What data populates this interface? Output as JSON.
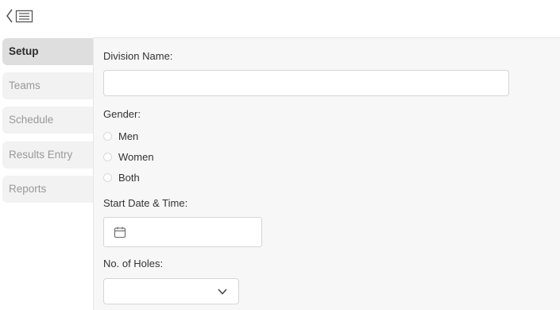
{
  "sidebar": {
    "items": [
      {
        "label": "Setup",
        "active": true
      },
      {
        "label": "Teams",
        "active": false
      },
      {
        "label": "Schedule",
        "active": false
      },
      {
        "label": "Results Entry",
        "active": false
      },
      {
        "label": "Reports",
        "active": false
      }
    ]
  },
  "form": {
    "division_name_label": "Division Name:",
    "division_name_value": "",
    "gender_label": "Gender:",
    "gender_options": [
      "Men",
      "Women",
      "Both"
    ],
    "gender_selected": "",
    "start_label": "Start Date & Time:",
    "start_value": "",
    "holes_label": "No. of Holes:",
    "holes_selected": ""
  },
  "icons": {
    "top": "collapse-menu-icon",
    "date": "calendar-icon",
    "select": "chevron-down-icon"
  },
  "colors": {
    "active_nav_bg": "#dedede",
    "nav_bg": "#f2f2f2",
    "content_bg": "#f7f7f7",
    "inactive_text": "#999999"
  }
}
